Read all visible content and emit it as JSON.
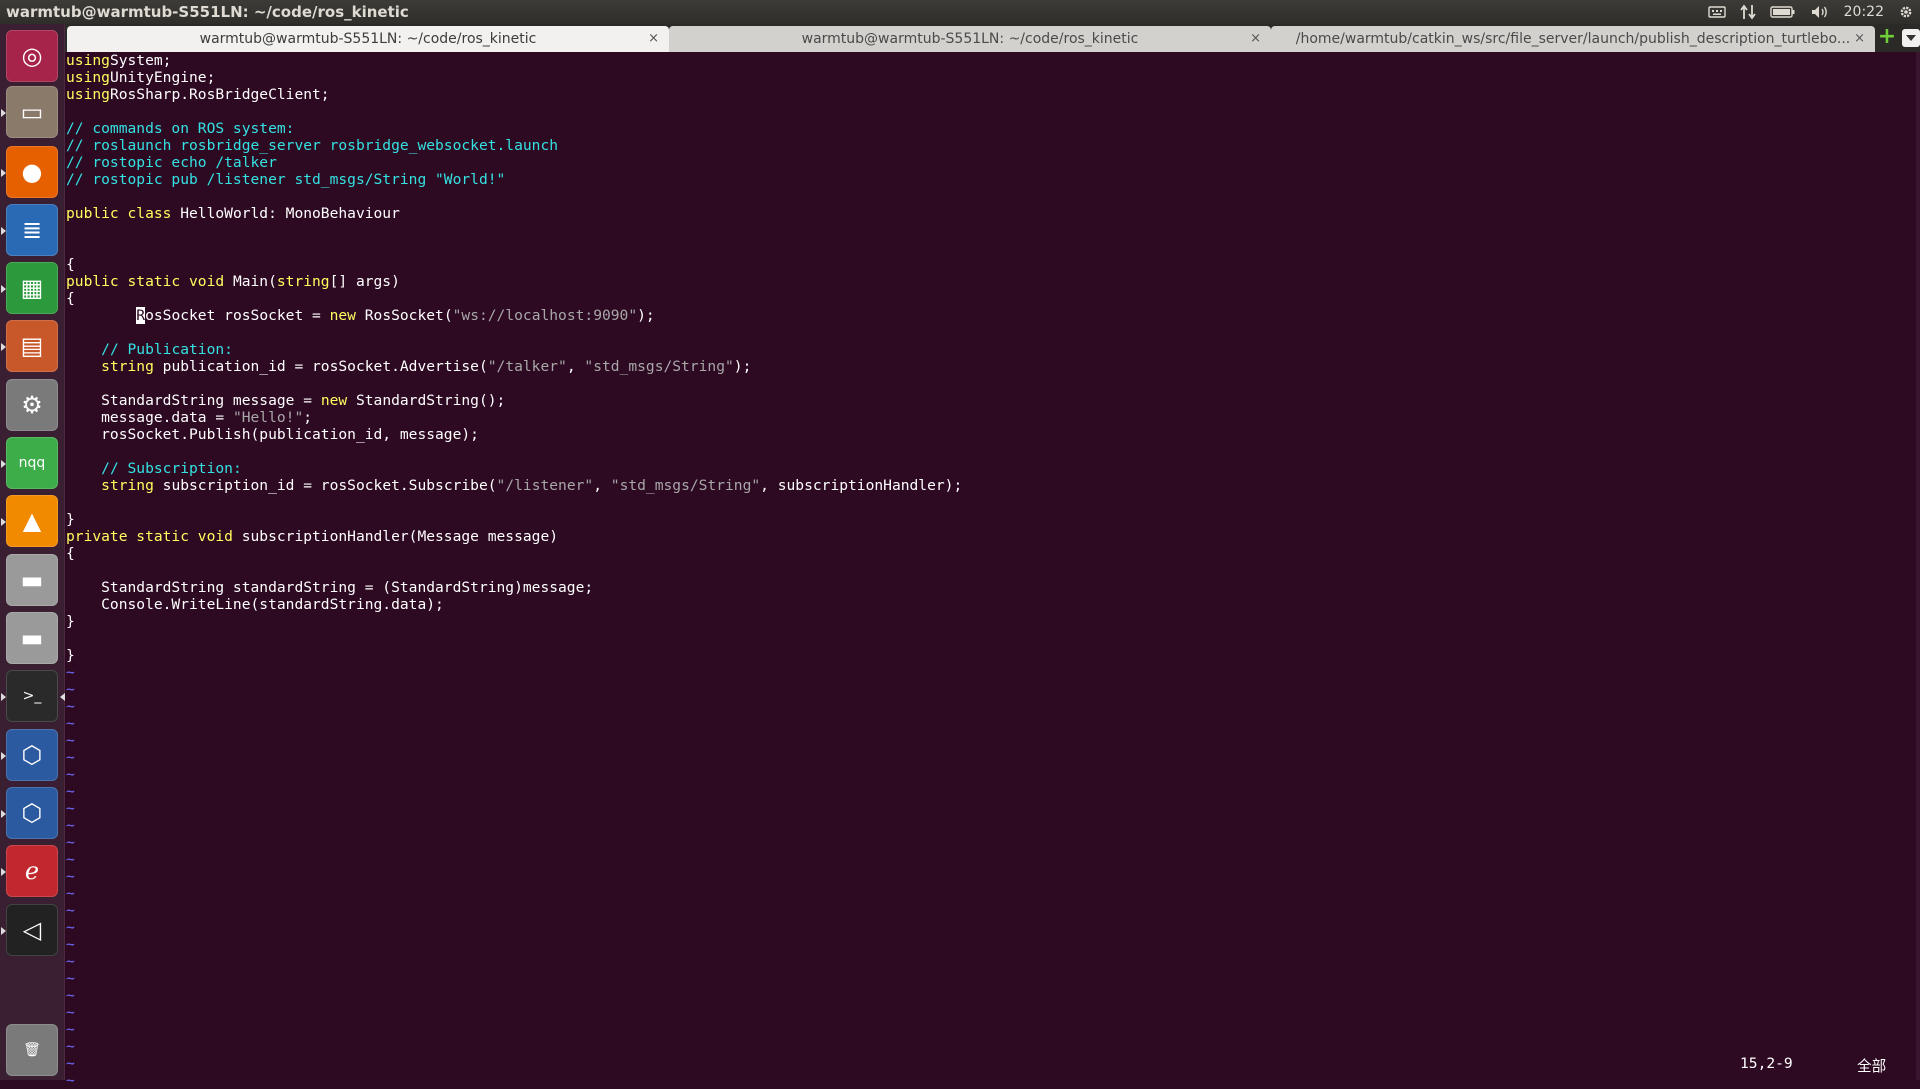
{
  "panel": {
    "title": "warmtub@warmtub-S551LN: ~/code/ros_kinetic",
    "clock": "20:22"
  },
  "launcher": {
    "items": [
      {
        "name": "ubuntu-dash-icon",
        "glyph": "◎",
        "color": "#a6244a"
      },
      {
        "name": "files-icon",
        "glyph": "▭",
        "color": "#8a7a6a"
      },
      {
        "name": "firefox-icon",
        "glyph": "●",
        "color": "#e66000"
      },
      {
        "name": "writer-icon",
        "glyph": "≣",
        "color": "#2a6ab5"
      },
      {
        "name": "calc-icon",
        "glyph": "▦",
        "color": "#2c9a3c"
      },
      {
        "name": "impress-icon",
        "glyph": "▤",
        "color": "#c8582a"
      },
      {
        "name": "settings-icon",
        "glyph": "⚙",
        "color": "#7a7a7a"
      },
      {
        "name": "nqq-icon",
        "glyph": "nqq",
        "color": "#3cad48"
      },
      {
        "name": "vlc-icon",
        "glyph": "▲",
        "color": "#f28a00"
      },
      {
        "name": "drive-icon",
        "glyph": "▬",
        "color": "#9a9a9a"
      },
      {
        "name": "drive-icon-2",
        "glyph": "▬",
        "color": "#9a9a9a"
      },
      {
        "name": "terminal-icon",
        "glyph": ">_",
        "color": "#2a2a2a"
      },
      {
        "name": "virtualbox-icon",
        "glyph": "⬡",
        "color": "#2c5aa0"
      },
      {
        "name": "virtualbox-icon-2",
        "glyph": "⬡",
        "color": "#2c5aa0"
      },
      {
        "name": "pdf-viewer-icon",
        "glyph": "ℯ",
        "color": "#c0282d"
      },
      {
        "name": "unity-icon",
        "glyph": "◁",
        "color": "#222222"
      },
      {
        "name": "trash-icon",
        "glyph": "🗑",
        "color": "#7a7a7a"
      }
    ]
  },
  "tabs": [
    {
      "label": "warmtub@warmtub-S551LN: ~/code/ros_kinetic",
      "close": "×",
      "active": true
    },
    {
      "label": "warmtub@warmtub-S551LN: ~/code/ros_kinetic",
      "close": "×",
      "active": false
    },
    {
      "label": "/home/warmtub/catkin_ws/src/file_server/launch/publish_description_turtlebo...",
      "close": "×",
      "active": false
    }
  ],
  "new_tab": "+",
  "code": [
    [
      [
        "kw",
        "using"
      ],
      [
        "",
        "System;"
      ]
    ],
    [
      [
        "kw",
        "using"
      ],
      [
        "",
        "UnityEngine;"
      ]
    ],
    [
      [
        "kw",
        "using"
      ],
      [
        "",
        "RosSharp.RosBridgeClient;"
      ]
    ],
    [],
    [
      [
        "cm",
        "// commands on ROS system:"
      ]
    ],
    [
      [
        "cm",
        "// roslaunch rosbridge_server rosbridge_websocket.launch"
      ]
    ],
    [
      [
        "cm",
        "// rostopic echo /talker"
      ]
    ],
    [
      [
        "cm",
        "// rostopic pub /listener std_msgs/String \"World!\""
      ]
    ],
    [],
    [
      [
        "kw",
        "public class"
      ],
      [
        "",
        " HelloWorld: MonoBehaviour"
      ]
    ],
    [],
    [],
    [
      [
        "",
        "{"
      ]
    ],
    [
      [
        "kw",
        "public static void"
      ],
      [
        "",
        " Main("
      ],
      [
        "kw",
        "string"
      ],
      [
        "",
        "[] args)"
      ]
    ],
    [
      [
        "",
        "{"
      ]
    ],
    [
      [
        "",
        "        "
      ],
      [
        "cursor",
        "R"
      ],
      [
        "",
        "osSocket rosSocket = "
      ],
      [
        "kw",
        "new"
      ],
      [
        "",
        " RosSocket("
      ],
      [
        "str",
        "\"ws://localhost:9090\""
      ],
      [
        "",
        ");"
      ]
    ],
    [],
    [
      [
        "",
        "    "
      ],
      [
        "cm",
        "// Publication:"
      ]
    ],
    [
      [
        "",
        "    "
      ],
      [
        "kw",
        "string"
      ],
      [
        "",
        " publication_id = rosSocket.Advertise("
      ],
      [
        "str",
        "\"/talker\""
      ],
      [
        "",
        ", "
      ],
      [
        "str",
        "\"std_msgs/String\""
      ],
      [
        "",
        ");"
      ]
    ],
    [],
    [
      [
        "",
        "    StandardString message = "
      ],
      [
        "kw",
        "new"
      ],
      [
        "",
        " StandardString();"
      ]
    ],
    [
      [
        "",
        "    message.data = "
      ],
      [
        "str",
        "\"Hello!\""
      ],
      [
        "",
        ";"
      ]
    ],
    [
      [
        "",
        "    rosSocket.Publish(publication_id, message);"
      ]
    ],
    [],
    [
      [
        "",
        "    "
      ],
      [
        "cm",
        "// Subscription:"
      ]
    ],
    [
      [
        "",
        "    "
      ],
      [
        "kw",
        "string"
      ],
      [
        "",
        " subscription_id = rosSocket.Subscribe("
      ],
      [
        "str",
        "\"/listener\""
      ],
      [
        "",
        ", "
      ],
      [
        "str",
        "\"std_msgs/String\""
      ],
      [
        "",
        ", subscriptionHandler);"
      ]
    ],
    [],
    [
      [
        "",
        "}"
      ]
    ],
    [
      [
        "kw",
        "private static void"
      ],
      [
        "",
        " subscriptionHandler(Message message)"
      ]
    ],
    [
      [
        "",
        "{"
      ]
    ],
    [],
    [
      [
        "",
        "    StandardString standardString = (StandardString)message;"
      ]
    ],
    [
      [
        "",
        "    Console.WriteLine(standardString.data);"
      ]
    ],
    [
      [
        "",
        "}"
      ]
    ],
    [],
    [
      [
        "",
        "}"
      ]
    ]
  ],
  "tilde_char": "~",
  "tilde_count": 25,
  "status": {
    "position": "15,2-9",
    "scroll": "全部"
  }
}
